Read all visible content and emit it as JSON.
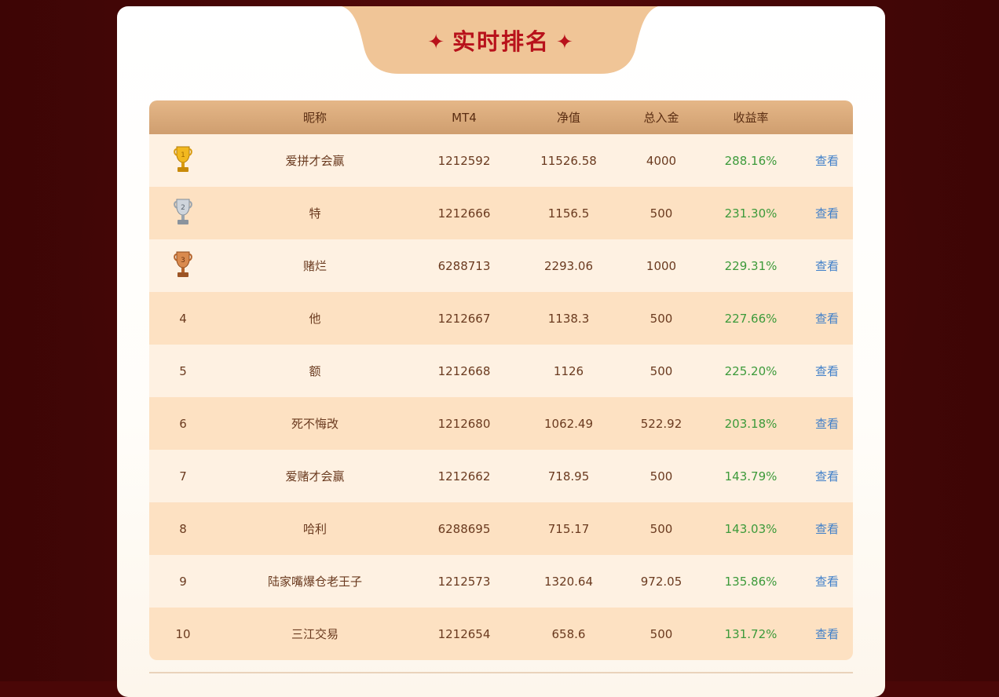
{
  "title": "实时排名",
  "title_star": "✦",
  "colors": {
    "background": "#4a0707",
    "accent_red": "#b8121b",
    "tab_bg": "#f0c597",
    "header_bg": "#d9a978",
    "row_light": "#fef1e2",
    "row_dark": "#fde1c2",
    "rate_green": "#3c9a3a",
    "link_blue": "#3f7fc9"
  },
  "table": {
    "headers": {
      "rank": "",
      "nickname": "昵称",
      "mt4": "MT4",
      "net_value": "净值",
      "total_deposit": "总入金",
      "return_rate": "收益率",
      "action": ""
    },
    "rows": [
      {
        "rank": "1",
        "rank_icon": "gold-trophy-icon",
        "nickname": "爱拼才会赢",
        "mt4": "1212592",
        "net_value": "11526.58",
        "total_deposit": "4000",
        "return_rate": "288.16%",
        "action": "查看"
      },
      {
        "rank": "2",
        "rank_icon": "silver-trophy-icon",
        "nickname": "特",
        "mt4": "1212666",
        "net_value": "1156.5",
        "total_deposit": "500",
        "return_rate": "231.30%",
        "action": "查看"
      },
      {
        "rank": "3",
        "rank_icon": "bronze-trophy-icon",
        "nickname": "赌烂",
        "mt4": "6288713",
        "net_value": "2293.06",
        "total_deposit": "1000",
        "return_rate": "229.31%",
        "action": "查看"
      },
      {
        "rank": "4",
        "nickname": "他",
        "mt4": "1212667",
        "net_value": "1138.3",
        "total_deposit": "500",
        "return_rate": "227.66%",
        "action": "查看"
      },
      {
        "rank": "5",
        "nickname": "额",
        "mt4": "1212668",
        "net_value": "1126",
        "total_deposit": "500",
        "return_rate": "225.20%",
        "action": "查看"
      },
      {
        "rank": "6",
        "nickname": "死不悔改",
        "mt4": "1212680",
        "net_value": "1062.49",
        "total_deposit": "522.92",
        "return_rate": "203.18%",
        "action": "查看"
      },
      {
        "rank": "7",
        "nickname": "爱赌才会赢",
        "mt4": "1212662",
        "net_value": "718.95",
        "total_deposit": "500",
        "return_rate": "143.79%",
        "action": "查看"
      },
      {
        "rank": "8",
        "nickname": "哈利",
        "mt4": "6288695",
        "net_value": "715.17",
        "total_deposit": "500",
        "return_rate": "143.03%",
        "action": "查看"
      },
      {
        "rank": "9",
        "nickname": "陆家嘴爆仓老王子",
        "mt4": "1212573",
        "net_value": "1320.64",
        "total_deposit": "972.05",
        "return_rate": "135.86%",
        "action": "查看"
      },
      {
        "rank": "10",
        "nickname": "三江交易",
        "mt4": "1212654",
        "net_value": "658.6",
        "total_deposit": "500",
        "return_rate": "131.72%",
        "action": "查看"
      }
    ]
  }
}
